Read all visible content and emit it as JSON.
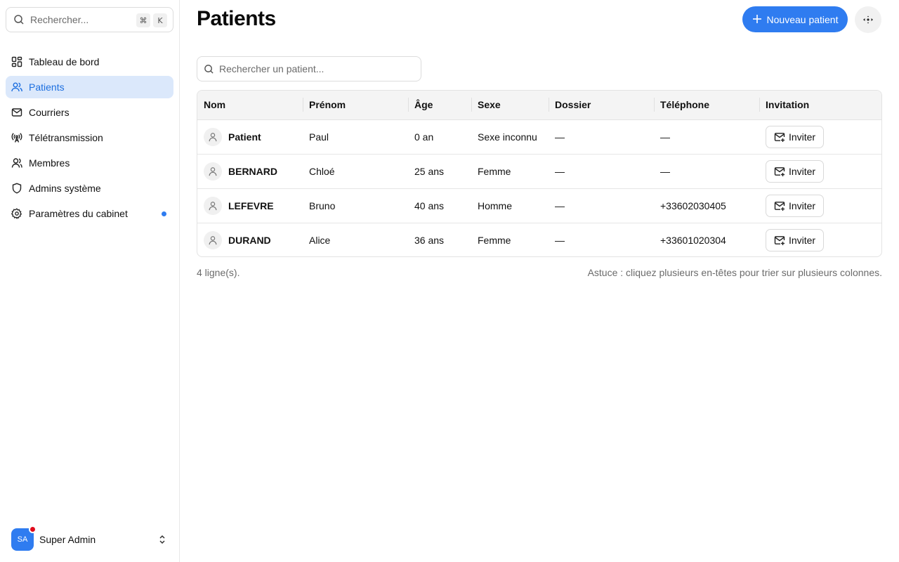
{
  "sidebar": {
    "search": {
      "placeholder": "Rechercher...",
      "kbd_cmd": "⌘",
      "kbd_key": "K"
    },
    "items": [
      {
        "label": "Tableau de bord",
        "icon": "dashboard-icon",
        "active": false
      },
      {
        "label": "Patients",
        "icon": "users-icon",
        "active": true
      },
      {
        "label": "Courriers",
        "icon": "mail-icon",
        "active": false
      },
      {
        "label": "Télétransmission",
        "icon": "antenna-icon",
        "active": false
      },
      {
        "label": "Membres",
        "icon": "user-icon",
        "active": false
      },
      {
        "label": "Admins système",
        "icon": "shield-icon",
        "active": false
      },
      {
        "label": "Paramètres du cabinet",
        "icon": "gear-icon",
        "active": false,
        "dot": true
      }
    ],
    "user": {
      "initials": "SA",
      "name": "Super Admin"
    }
  },
  "header": {
    "title": "Patients",
    "new_button_label": "Nouveau patient",
    "new_button_icon": "plus-icon"
  },
  "patient_search": {
    "placeholder": "Rechercher un patient..."
  },
  "table": {
    "columns": [
      "Nom",
      "Prénom",
      "Âge",
      "Sexe",
      "Dossier",
      "Téléphone",
      "Invitation"
    ],
    "rows": [
      {
        "nom": "Patient",
        "prenom": "Paul",
        "age": "0 an",
        "sexe": "Sexe inconnu",
        "dossier": "—",
        "telephone": "—",
        "invite": "Inviter"
      },
      {
        "nom": "BERNARD",
        "prenom": "Chloé",
        "age": "25 ans",
        "sexe": "Femme",
        "dossier": "—",
        "telephone": "—",
        "invite": "Inviter"
      },
      {
        "nom": "LEFEVRE",
        "prenom": "Bruno",
        "age": "40 ans",
        "sexe": "Homme",
        "dossier": "—",
        "telephone": "+33602030405",
        "invite": "Inviter"
      },
      {
        "nom": "DURAND",
        "prenom": "Alice",
        "age": "36 ans",
        "sexe": "Femme",
        "dossier": "—",
        "telephone": "+33601020304",
        "invite": "Inviter"
      }
    ]
  },
  "footer": {
    "row_count": "4 ligne(s).",
    "tip": "Astuce : cliquez plusieurs en-têtes pour trier sur plusieurs colonnes."
  },
  "colors": {
    "accent": "#2f7cf0",
    "active_bg": "#dbe8fb",
    "badge_red": "#e00b1c"
  }
}
